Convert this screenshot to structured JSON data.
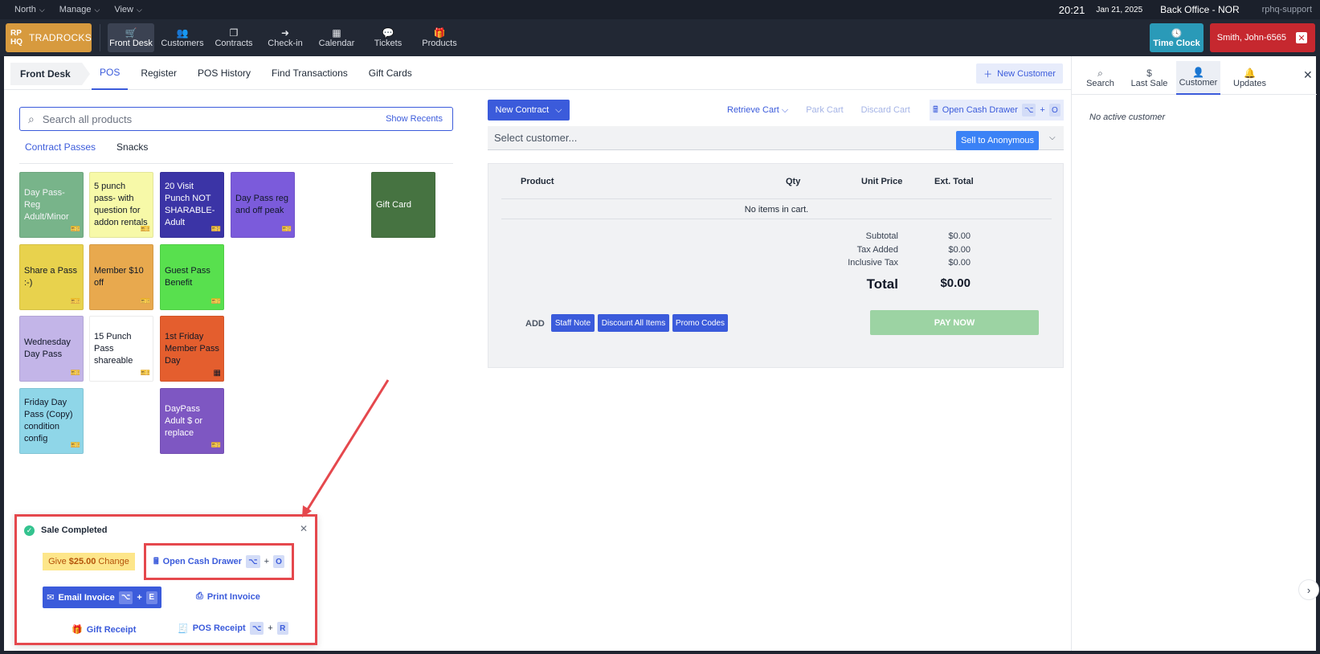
{
  "sysbar": {
    "menus": [
      "North",
      "Manage",
      "View"
    ],
    "time": "20:21",
    "date": "Jan 21, 2025",
    "office": "Back Office - NOR",
    "support": "rphq-support"
  },
  "navbar": {
    "logo_mark": "RP HQ",
    "logo_name": "TRADROCKS",
    "items": [
      {
        "label": "Front Desk",
        "icon": "cart-icon",
        "glyph": "🛒"
      },
      {
        "label": "Customers",
        "icon": "users-icon",
        "glyph": "👥"
      },
      {
        "label": "Contracts",
        "icon": "contracts-icon",
        "glyph": "❐"
      },
      {
        "label": "Check-in",
        "icon": "checkin-icon",
        "glyph": "➜"
      },
      {
        "label": "Calendar",
        "icon": "calendar-icon",
        "glyph": "▦"
      },
      {
        "label": "Tickets",
        "icon": "tickets-icon",
        "glyph": "💬"
      },
      {
        "label": "Products",
        "icon": "products-icon",
        "glyph": "🎁"
      }
    ],
    "time_clock": "Time Clock",
    "user": "Smith, John-6565"
  },
  "tabs": {
    "crumb": "Front Desk",
    "items": [
      "POS",
      "Register",
      "POS History",
      "Find Transactions",
      "Gift Cards"
    ],
    "new_customer": "New Customer"
  },
  "search": {
    "placeholder": "Search all products",
    "show_recents": "Show Recents"
  },
  "categories": [
    "Contract Passes",
    "Snacks"
  ],
  "tiles": [
    {
      "label": "Day Pass- Reg Adult/Minor",
      "color": "#78b48a",
      "text": "#f3f4f6"
    },
    {
      "label": "5 punch pass- with question for addon rentals",
      "color": "#f7f9a8",
      "text": "#111827"
    },
    {
      "label": "20 Visit Punch NOT SHARABLE- Adult",
      "color": "#3b34a6",
      "text": "#ffffff"
    },
    {
      "label": "Day Pass reg and off peak",
      "color": "#7b5bdb",
      "text": "#111827"
    },
    {
      "label": "Gift Card",
      "color": "#467341",
      "text": "#ffffff"
    },
    {
      "label": "Share a Pass :-)",
      "color": "#e8d24d",
      "text": "#111827"
    },
    {
      "label": "Member $10 off",
      "color": "#e8a94e",
      "text": "#111827"
    },
    {
      "label": "Guest Pass Benefit",
      "color": "#58e04e",
      "text": "#111827"
    },
    {
      "label": "Wednesday Day Pass",
      "color": "#c3b5e8",
      "text": "#111827"
    },
    {
      "label": "15 Punch Pass shareable",
      "color": "#ffffff",
      "text": "#111827"
    },
    {
      "label": "1st Friday Member Pass Day",
      "color": "#e45e2e",
      "text": "#111827"
    },
    {
      "label": "Friday Day Pass (Copy) condition config",
      "color": "#8fd6e8",
      "text": "#111827"
    },
    {
      "label": "DayPass Adult $ or replace",
      "color": "#7e57c2",
      "text": "#ffffff"
    }
  ],
  "cart": {
    "new_contract": "New Contract",
    "retrieve": "Retrieve Cart",
    "park": "Park Cart",
    "discard": "Discard Cart",
    "open_cash": "Open Cash Drawer",
    "key_plus": "+",
    "key_o": "O",
    "customer_placeholder": "Select customer...",
    "anonymous": "Sell to Anonymous",
    "headers": {
      "product": "Product",
      "qty": "Qty",
      "unit": "Unit Price",
      "ext": "Ext. Total"
    },
    "empty": "No items in cart.",
    "subtotal_label": "Subtotal",
    "subtotal": "$0.00",
    "tax_label": "Tax Added",
    "tax": "$0.00",
    "incl_label": "Inclusive Tax",
    "incl": "$0.00",
    "total_label": "Total",
    "total": "$0.00",
    "add": "ADD",
    "staff_note": "Staff Note",
    "discount_all": "Discount All Items",
    "promo": "Promo Codes",
    "pay_now": "PAY NOW"
  },
  "rpanel": {
    "tabs": [
      {
        "label": "Search",
        "glyph": "⌕"
      },
      {
        "label": "Last Sale",
        "glyph": "$"
      },
      {
        "label": "Customer",
        "glyph": "👤"
      },
      {
        "label": "Updates",
        "glyph": "🔔"
      }
    ],
    "no_customer": "No active customer"
  },
  "toast": {
    "title": "Sale Completed",
    "give": "Give",
    "amount": "$25.00",
    "change": "Change",
    "open_cash": "Open Cash Drawer",
    "email": "Email Invoice",
    "key_e": "E",
    "print": "Print Invoice",
    "gift": "Gift Receipt",
    "pos_receipt": "POS Receipt",
    "key_r": "R"
  }
}
